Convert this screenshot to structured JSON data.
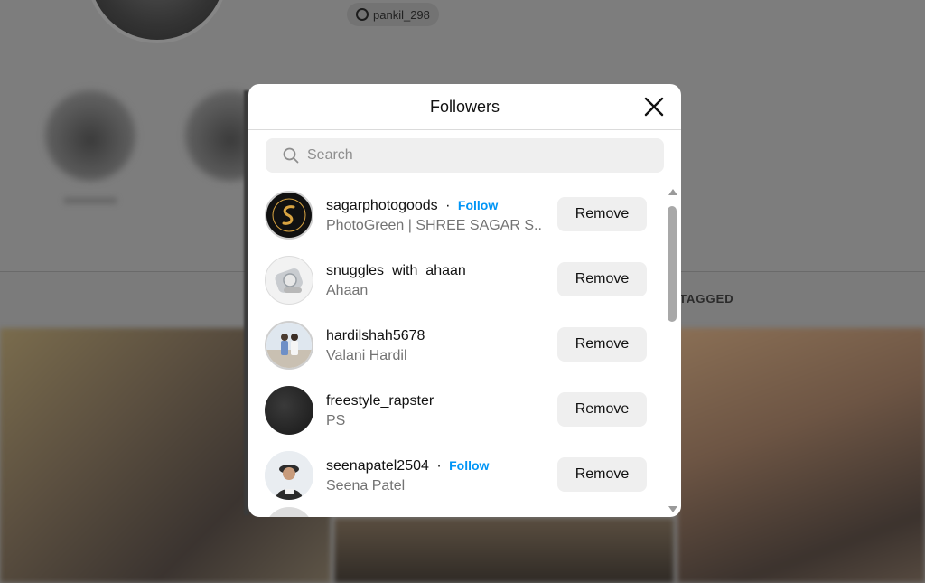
{
  "background": {
    "threads_handle": "pankil_298",
    "tagged_tab": "TAGGED"
  },
  "modal": {
    "title": "Followers",
    "close_icon": "close-icon",
    "search": {
      "placeholder": "Search",
      "value": ""
    },
    "separator": "·",
    "remove_label": "Remove",
    "follow_label": "Follow",
    "followers": [
      {
        "username": "sagarphotogoods",
        "full_name": "PhotoGreen | SHREE SAGAR S...",
        "show_follow": true
      },
      {
        "username": "snuggles_with_ahaan",
        "full_name": "Ahaan",
        "show_follow": false
      },
      {
        "username": "hardilshah5678",
        "full_name": "Valani Hardil",
        "show_follow": false
      },
      {
        "username": "freestyle_rapster",
        "full_name": "PS",
        "show_follow": false
      },
      {
        "username": "seenapatel2504",
        "full_name": "Seena Patel",
        "show_follow": true
      }
    ]
  },
  "colors": {
    "accent": "#0095f6",
    "button_bg": "#efefef",
    "secondary_text": "#737373"
  }
}
